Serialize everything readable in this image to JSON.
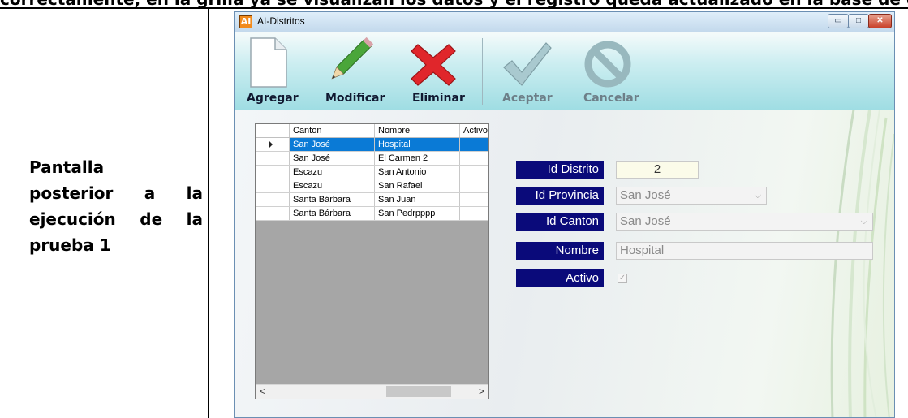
{
  "document": {
    "cut_off_heading": "correctamente, en la grilla ya se visualizan los datos y el registro queda actualizado en la base de datos",
    "cell_label_lines": [
      "Pantalla",
      "posterior a la",
      "ejecución de la",
      "prueba 1"
    ]
  },
  "window": {
    "icon_text": "AI",
    "title": "AI-Distritos",
    "controls": {
      "minimize": "▭",
      "maximize": "□",
      "close": "✕"
    }
  },
  "toolbar": {
    "buttons": [
      {
        "label": "Agregar",
        "icon": "blank-page-icon",
        "enabled": true
      },
      {
        "label": "Modificar",
        "icon": "pencil-icon",
        "enabled": true
      },
      {
        "label": "Eliminar",
        "icon": "red-x-icon",
        "enabled": true
      },
      {
        "label": "Aceptar",
        "icon": "checkmark-icon",
        "enabled": false
      },
      {
        "label": "Cancelar",
        "icon": "cancel-circle-icon",
        "enabled": false
      }
    ]
  },
  "grid": {
    "columns": [
      "",
      "Canton",
      "Nombre",
      "Activo"
    ],
    "rows": [
      {
        "canton": "San José",
        "nombre": "Hospital",
        "selected": true
      },
      {
        "canton": "San José",
        "nombre": "El Carmen 2",
        "selected": false
      },
      {
        "canton": "Escazu",
        "nombre": "San Antonio",
        "selected": false
      },
      {
        "canton": "Escazu",
        "nombre": "San Rafael",
        "selected": false
      },
      {
        "canton": "Santa Bárbara",
        "nombre": "San Juan",
        "selected": false
      },
      {
        "canton": "Santa Bárbara",
        "nombre": "San Pedrpppp",
        "selected": false
      }
    ],
    "scroll_left": "<",
    "scroll_right": ">"
  },
  "form": {
    "id_distrito": {
      "label": "Id Distrito",
      "value": "2"
    },
    "id_provincia": {
      "label": "Id Provincia",
      "value": "San José"
    },
    "id_canton": {
      "label": "Id Canton",
      "value": "San José"
    },
    "nombre": {
      "label": "Nombre",
      "value": "Hospital"
    },
    "activo": {
      "label": "Activo",
      "checked": true
    }
  },
  "colors": {
    "label_bg": "#0a0a7a",
    "selection": "#0a7ad6",
    "delete_red": "#e0262b",
    "pencil_green": "#4aa63a"
  }
}
